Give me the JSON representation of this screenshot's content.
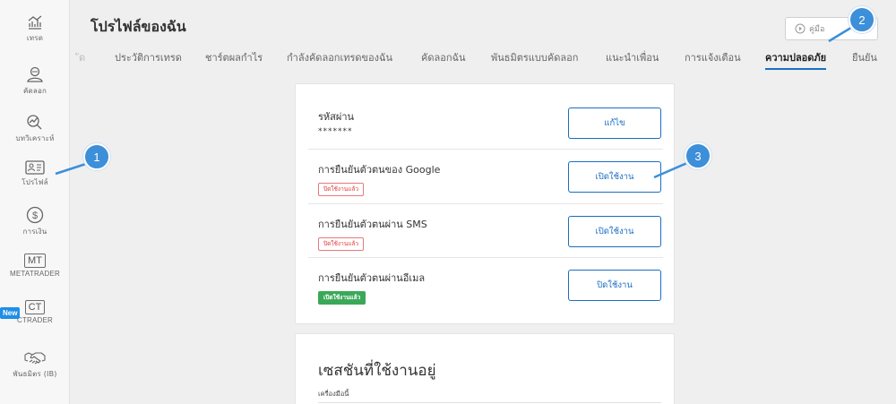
{
  "sidebar": {
    "items": [
      {
        "label": "เทรด",
        "icon": "trade-chart-icon"
      },
      {
        "label": "คัดลอก",
        "icon": "copy-person-icon"
      },
      {
        "label": "บทวิเคราะห์",
        "icon": "analysis-icon"
      },
      {
        "label": "โปรไฟล์",
        "icon": "profile-card-icon"
      },
      {
        "label": "การเงิน",
        "icon": "dollar-icon"
      },
      {
        "label": "METATRADER",
        "icon_text": "MT"
      },
      {
        "label": "CTRADER",
        "icon_text": "CT",
        "badge": "New"
      },
      {
        "label": "พันธมิตร (IB)",
        "icon": "handshake-icon"
      }
    ]
  },
  "header": {
    "title": "โปรไฟล์ของฉัน",
    "guide_label": "คู่มือ"
  },
  "tabs": [
    {
      "label": "ัด",
      "state": "faded"
    },
    {
      "label": "ประวัติการเทรด",
      "state": "normal"
    },
    {
      "label": "ชาร์ตผลกำไร",
      "state": "normal"
    },
    {
      "label": "กำลังคัดลอกเทรดของฉัน",
      "state": "normal"
    },
    {
      "label": "คัดลอกฉัน",
      "state": "normal"
    },
    {
      "label": "พันธมิตรแบบคัดลอก",
      "state": "normal"
    },
    {
      "label": "แนะนำเพื่อน",
      "state": "normal"
    },
    {
      "label": "การแจ้งเตือน",
      "state": "normal"
    },
    {
      "label": "ความปลอดภัย",
      "state": "active"
    },
    {
      "label": "ยืนยัน",
      "state": "normal"
    }
  ],
  "security": {
    "password": {
      "title": "รหัสผ่าน",
      "value": "*******",
      "button": "แก้ไข"
    },
    "google": {
      "title": "การยืนยันตัวตนของ Google",
      "status": "ปิดใช้งานแล้ว",
      "button": "เปิดใช้งาน"
    },
    "sms": {
      "title": "การยืนยันตัวตนผ่าน SMS",
      "status": "ปิดใช้งานแล้ว",
      "button": "เปิดใช้งาน"
    },
    "email": {
      "title": "การยืนยันตัวตนผ่านอีเมล",
      "status": "เปิดใช้งานแล้ว",
      "button": "ปิดใช้งาน"
    }
  },
  "sessions": {
    "title": "เซสชันที่ใช้งานอยู่",
    "subtitle": "เครื่องมือนี้"
  },
  "callouts": [
    "1",
    "2",
    "3"
  ],
  "colors": {
    "accent": "#1a6ec4",
    "callout": "#3d8fd9",
    "status_red": "#e03b3b",
    "status_green": "#3aa858",
    "new_badge": "#1f8ee6"
  }
}
